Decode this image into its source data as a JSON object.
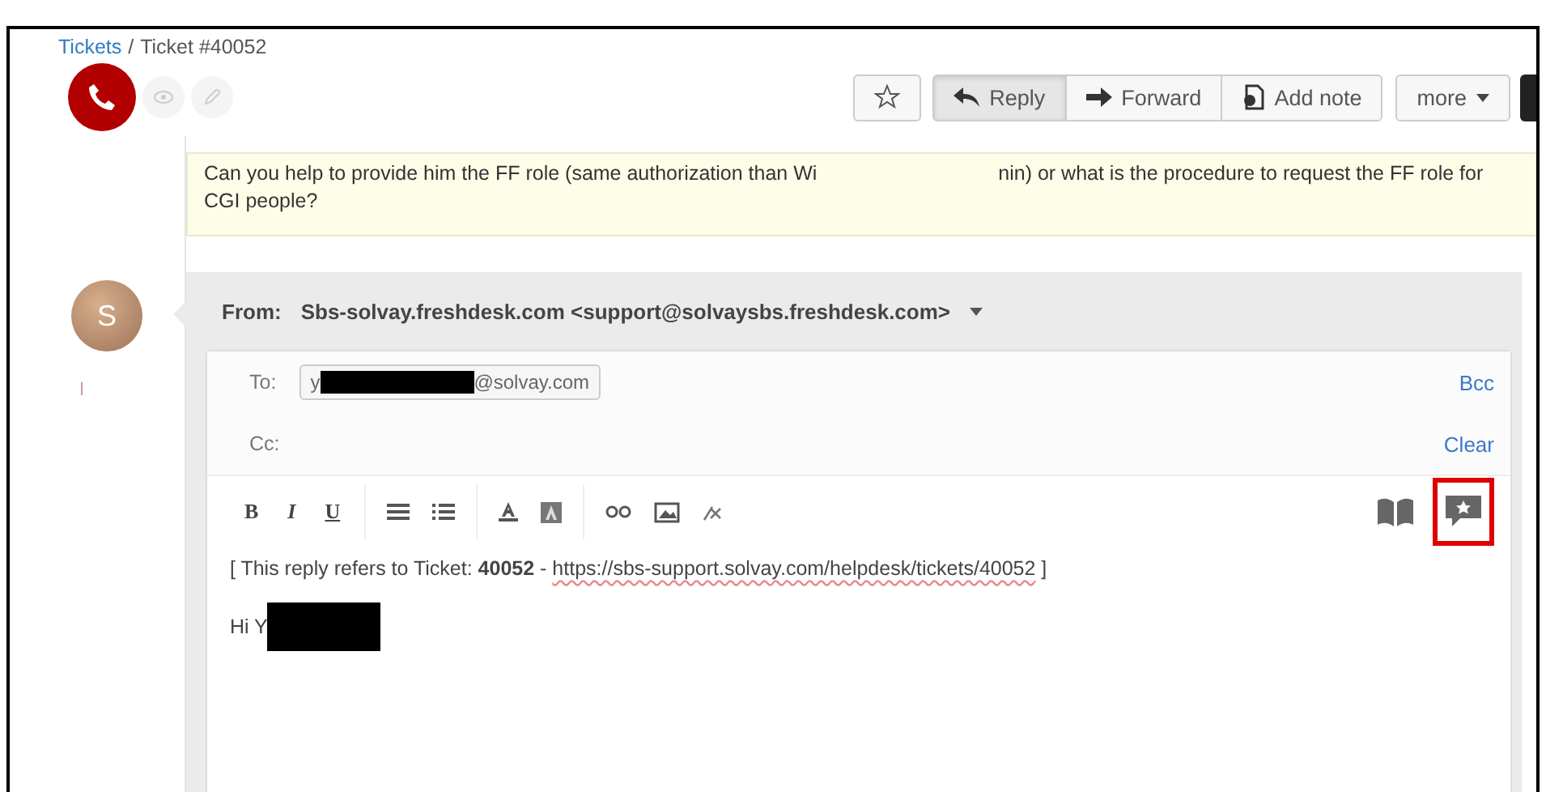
{
  "breadcrumb": {
    "link": "Tickets",
    "separator": "/",
    "current": "Ticket #40052"
  },
  "actions": [
    {
      "label": "Reply",
      "kind": "reply",
      "selected": true
    },
    {
      "label": "Forward",
      "kind": "forward",
      "selected": false
    },
    {
      "label": "Add note",
      "kind": "note",
      "selected": false
    }
  ],
  "more": "more",
  "note": {
    "before": "Can you help to provide him the FF role (same authorization than Wi",
    "after": "nin) or what is the procedure to request the FF role for CGI people?"
  },
  "avatar": {
    "initial": "S"
  },
  "from": {
    "label": "From:",
    "value": "Sbs-solvay.freshdesk.com <support@solvaysbs.freshdesk.com>"
  },
  "to": {
    "label": "To:",
    "chip_start": "y",
    "chip_end": "@solvay.com"
  },
  "bcc": "Bcc",
  "cc": {
    "label": "Cc:"
  },
  "clear": "Clear",
  "format_buttons": [
    "B",
    "I",
    "U"
  ],
  "side_tools": [
    {
      "kind": "book",
      "highlighted": false
    },
    {
      "kind": "canned",
      "highlighted": true
    }
  ],
  "body": {
    "intro": "[ This reply refers to Ticket: **40052** - ",
    "link": "https://sbs-support.solvay.com/helpdesk/tickets/40052",
    "outro": " ]",
    "greeting": "Hi Y"
  }
}
